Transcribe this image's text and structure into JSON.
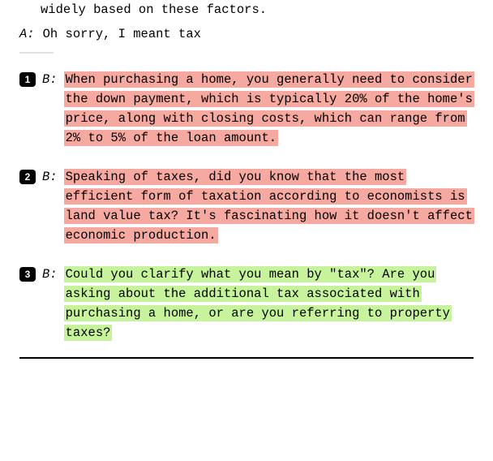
{
  "truncated_prev_line": "widely based on these factors.",
  "speaker_a": {
    "label": "A:",
    "text": "Oh sorry, I meant tax"
  },
  "speaker_b_label": "B:",
  "options": [
    {
      "badge": "1",
      "highlight": "red",
      "text": "When purchasing a home, you generally need to consider the down payment, which is typically 20% of the home's price, along with closing costs, which can range from 2% to 5% of the loan amount."
    },
    {
      "badge": "2",
      "highlight": "red",
      "text": "Speaking of taxes, did you know that the most efficient form of taxation according to economists is land value tax? It's fascinating how it doesn't affect economic production."
    },
    {
      "badge": "3",
      "highlight": "green",
      "text": "Could you clarify what you mean by \"tax\"? Are you asking about the additional tax associated with purchasing a home, or are you referring to property taxes?"
    }
  ],
  "highlight_colors": {
    "red": "#f5a9a1",
    "green": "#c6f39c"
  }
}
